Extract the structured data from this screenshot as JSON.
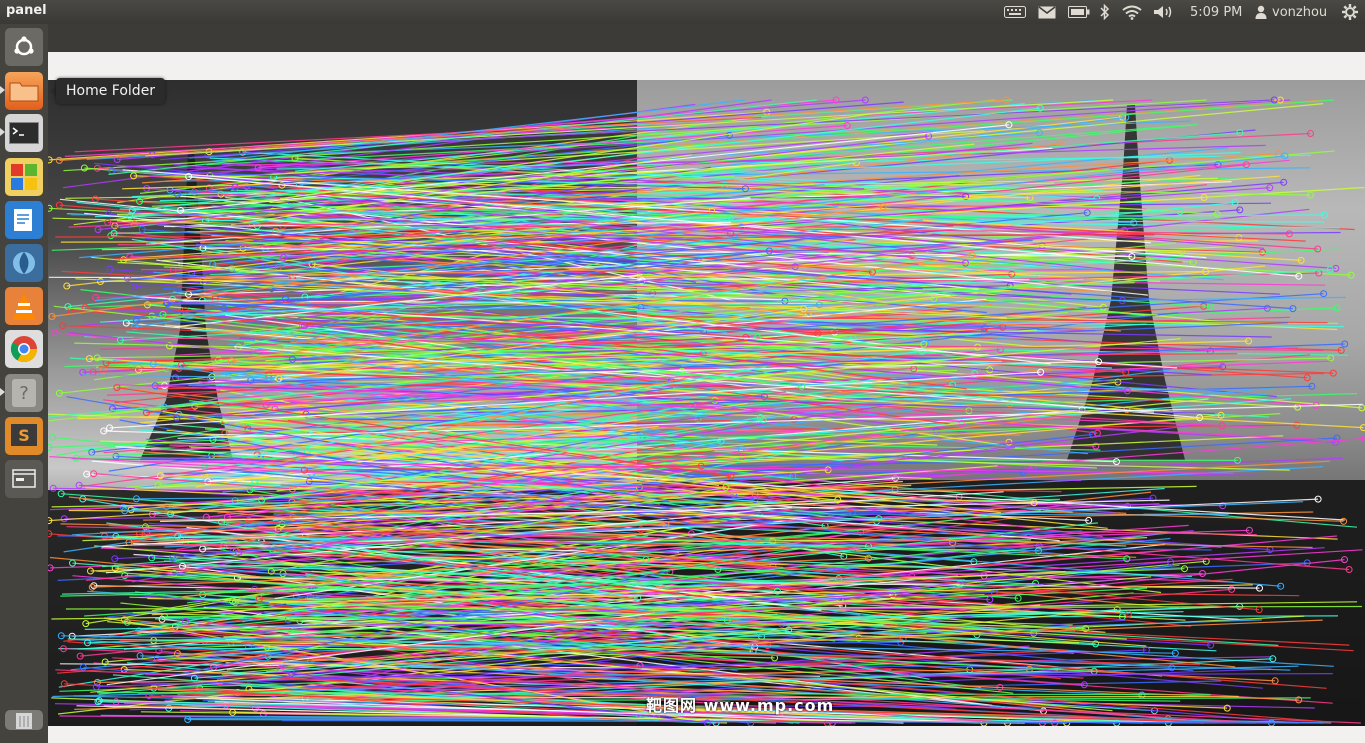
{
  "panel": {
    "title": "panel",
    "clock": "5:09 PM",
    "user": "vonzhou",
    "indicators": [
      "keyboard-icon",
      "mail-icon",
      "battery-icon",
      "bluetooth-icon",
      "wifi-icon",
      "volume-icon",
      "session-gear-icon"
    ]
  },
  "launcher": {
    "items": [
      {
        "name": "dash-home",
        "icon": "ubuntu-logo-icon"
      },
      {
        "name": "home-folder",
        "icon": "folder-icon",
        "tooltip": "Home Folder"
      },
      {
        "name": "terminal",
        "icon": "terminal-icon"
      },
      {
        "name": "windows-app",
        "icon": "windows-logo-icon"
      },
      {
        "name": "text-editor",
        "icon": "writer-icon"
      },
      {
        "name": "shotwell",
        "icon": "shotwell-icon"
      },
      {
        "name": "vlc",
        "icon": "vlc-cone-icon"
      },
      {
        "name": "chrome",
        "icon": "chrome-icon"
      },
      {
        "name": "help",
        "icon": "question-mark-icon"
      },
      {
        "name": "sublime-text",
        "icon": "sublime-s-icon"
      },
      {
        "name": "workspace-switcher",
        "icon": "window-icon"
      },
      {
        "name": "trash",
        "icon": "trash-icon"
      }
    ]
  },
  "image": {
    "watermark": "靶图网 www.mp.com"
  },
  "colors": {
    "panel_bg": "#3c3b37",
    "launcher_bg": "#46443e",
    "window_bar": "#f2f1f0",
    "tooltip_bg": "#2b2b2b"
  }
}
